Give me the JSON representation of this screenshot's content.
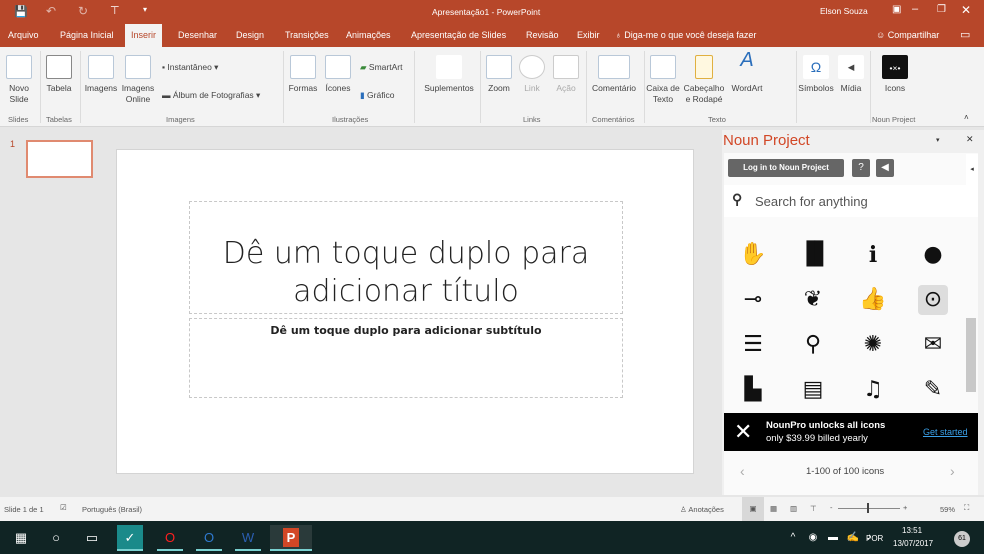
{
  "window": {
    "title": "Apresentação1 - PowerPoint",
    "user": "Elson Souza"
  },
  "tabs": [
    "Arquivo",
    "Página Inicial",
    "Inserir",
    "Desenhar",
    "Design",
    "Transições",
    "Animações",
    "Apresentação de Slides",
    "Revisão",
    "Exibir"
  ],
  "tell_me": "Diga-me o que você deseja fazer",
  "share": "Compartilhar",
  "ribbon": {
    "novo_slide": "Novo Slide",
    "tabela": "Tabela",
    "imagens": "Imagens",
    "imagens_online": "Imagens Online",
    "instantaneo": "Instantâneo",
    "album": "Álbum de Fotografias",
    "formas": "Formas",
    "icones": "Ícones",
    "smartart": "SmartArt",
    "grafico": "Gráfico",
    "suplementos": "Suplementos",
    "zoom": "Zoom",
    "link": "Link",
    "acao": "Ação",
    "comentario": "Comentário",
    "caixa_texto": "Caixa de Texto",
    "cabecalho": "Cabeçalho e Rodapé",
    "wordart": "WordArt",
    "simbolos": "Símbolos",
    "midia": "Mídia",
    "icons": "Icons",
    "groups": {
      "slides": "Slides",
      "tabelas": "Tabelas",
      "imagens": "Imagens",
      "ilustracoes": "Ilustrações",
      "links": "Links",
      "comentarios": "Comentários",
      "texto": "Texto",
      "noun": "Noun Project"
    }
  },
  "thumbnail_number": "1",
  "slide": {
    "title": "Dê um toque duplo para adicionar título",
    "subtitle": "Dê um toque duplo para adicionar subtítulo"
  },
  "panel": {
    "title": "Noun Project",
    "login": "Log in to Noun Project",
    "search_placeholder": "Search for anything",
    "promo_line1": "NounPro unlocks all icons",
    "promo_line2": "only $39.99 billed yearly",
    "promo_link": "Get started",
    "pagination": "1-100 of 100 icons"
  },
  "status": {
    "slide": "Slide 1 de 1",
    "language": "Português (Brasil)",
    "notes": "Anotações",
    "zoom": "59%"
  },
  "taskbar": {
    "lang": "POR",
    "time": "13:51",
    "date": "13/07/2017",
    "notifications": "61"
  },
  "colors": {
    "accent": "#b7472a",
    "taskbar": "#102424"
  }
}
